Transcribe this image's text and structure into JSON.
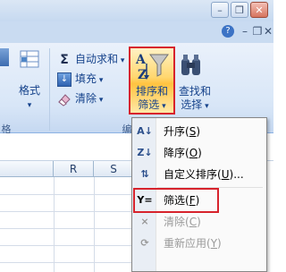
{
  "ribbon": {
    "help_icon": "help-icon",
    "format_label": "格式",
    "autosum_label": "自动求和",
    "fill_label": "填充",
    "clear_label": "清除",
    "sort_filter_line1": "排序和",
    "sort_filter_line2": "筛选",
    "find_select_line1": "查找和",
    "find_select_line2": "选择",
    "group_cells_partial": "格",
    "group_edit_partial": "编"
  },
  "sheet": {
    "columns": [
      "R",
      "S"
    ]
  },
  "menu": {
    "items": [
      {
        "icon": "sort-ascending-icon",
        "label": "升序",
        "shortcut": "S",
        "enabled": true
      },
      {
        "icon": "sort-descending-icon",
        "label": "降序",
        "shortcut": "O",
        "enabled": true
      },
      {
        "icon": "custom-sort-icon",
        "label": "自定义排序",
        "shortcut": "U",
        "suffix": "...",
        "enabled": true
      },
      {
        "icon": "filter-icon",
        "label": "筛选",
        "shortcut": "F",
        "enabled": true
      },
      {
        "icon": "clear-filter-icon",
        "label": "清除",
        "shortcut": "C",
        "enabled": false
      },
      {
        "icon": "reapply-icon",
        "label": "重新应用",
        "shortcut": "Y",
        "enabled": false
      }
    ]
  },
  "colors": {
    "highlight_border": "#d7232c",
    "ribbon_text": "#15428b",
    "button_active": "#ffc340"
  }
}
